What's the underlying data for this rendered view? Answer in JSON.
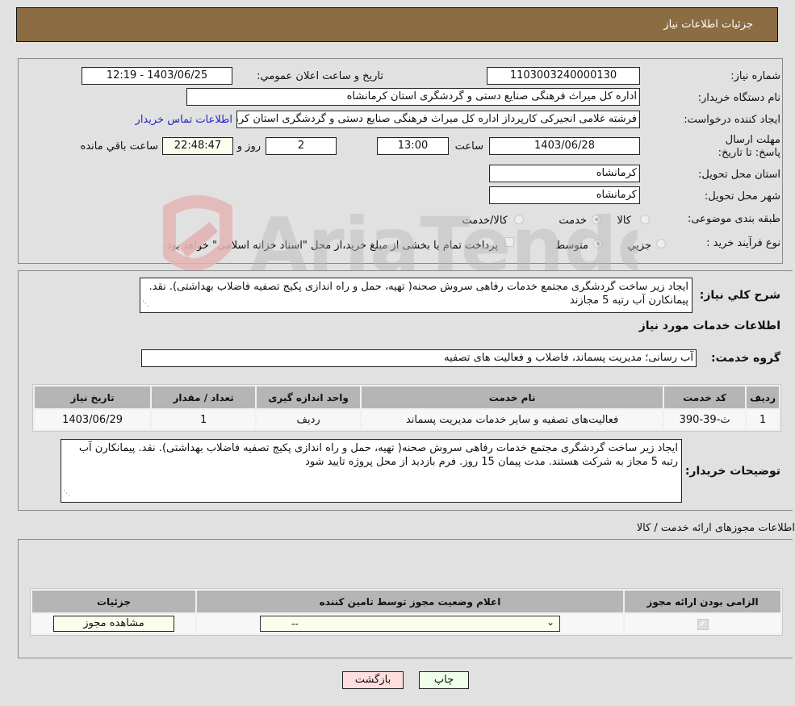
{
  "header": {
    "title": "جزئیات اطلاعات نیاز"
  },
  "details": {
    "need_number_label": "شماره نیاز:",
    "need_number": "1103003240000130",
    "announce_label": "تاریخ و ساعت اعلان عمومي:",
    "announce_value": "1403/06/25 - 12:19",
    "buyer_org_label": "نام دستگاه خریدار:",
    "buyer_org": "اداره کل میراث فرهنگی  صنایع دستی و گردشگری استان کرمانشاه",
    "creator_label": "ایجاد کننده درخواست:",
    "creator": "فرشته غلامی انجیرکی کارپرداز اداره کل میراث فرهنگی  صنایع دستی و گردشگری استان کرمانشاه",
    "buyer_contact_link": "اطلاعات تماس خریدار",
    "deadline_label": "مهلت ارسال پاسخ: تا تاریخ:",
    "deadline_date": "1403/06/28",
    "time_label": "ساعت",
    "deadline_time": "13:00",
    "days_value": "2",
    "days_label": "روز و",
    "remaining_time": "22:48:47",
    "remaining_label": "ساعت باقي مانده",
    "province_label": "استان محل تحویل:",
    "province": "کرمانشاه",
    "city_label": "شهر محل تحویل:",
    "city": "کرمانشاه",
    "category_label": "طبقه بندی موضوعی:",
    "category_options": [
      {
        "label": "کالا",
        "selected": false
      },
      {
        "label": "خدمت",
        "selected": true
      },
      {
        "label": "کالا/خدمت",
        "selected": false
      }
    ],
    "process_label": "نوع فرآیند خرید :",
    "process_options": [
      {
        "label": "جزيي",
        "selected": false
      },
      {
        "label": "متوسط",
        "selected": true
      }
    ],
    "treasury_checkbox_label": "پرداخت تمام یا بخشی از مبلغ خرید،از محل \"اسناد خزانه اسلامی\" خواهد بود."
  },
  "summary": {
    "label": "شرح کلي نیاز:",
    "text": "ایجاد زیر ساخت گردشگری مجتمع خدمات رفاهی سروش صحنه( تهیه، حمل و راه اندازی پکیج تصفیه فاضلاب بهداشتی). نقد. پیمانکارن آب رتبه 5 مجازند",
    "services_heading": "اطلاعات خدمات مورد نیاز",
    "service_group_label": "گروه خدمت:",
    "service_group": "آب رسانی؛ مدیریت پسماند، فاضلاب و فعالیت های تصفیه"
  },
  "services_table": {
    "headers": [
      "ردیف",
      "کد خدمت",
      "نام خدمت",
      "واحد اندازه گیری",
      "تعداد / مقدار",
      "تاریخ نیاز"
    ],
    "rows": [
      [
        "1",
        "ث-39-390",
        "فعالیت‌های تصفیه و سایر خدمات مدیریت پسماند",
        "ردیف",
        "1",
        "1403/06/29"
      ]
    ]
  },
  "buyer_notes": {
    "label": "توضیحات خریدار:",
    "text": "ایجاد زیر ساخت گردشگری مجتمع خدمات رفاهی سروش صحنه( تهیه، حمل و راه اندازی پکیج تصفیه فاضلاب بهداشتی). نقد. پیمانکارن آب رتبه 5 مجاز به شرکت هستند. مدت پیمان 15 روز. فرم بازدید از محل پروژه تایید شود"
  },
  "permits": {
    "heading": "اطلاعات مجوزهای ارائه خدمت / کالا",
    "headers": [
      "الزامی بودن ارائه مجوز",
      "اعلام وضعیت مجوز توسط تامین کننده",
      "جزئیات"
    ],
    "row": {
      "required_checked": true,
      "status_value": "--",
      "details_button": "مشاهده مجوز"
    }
  },
  "footer": {
    "print_button": "چاپ",
    "back_button": "بازگشت"
  },
  "colors": {
    "header_bg": "#8c6c42",
    "print_bg": "#eefee8",
    "back_bg": "#fedede",
    "link": "#2424c8"
  },
  "watermark": {
    "text": "AriaTender.neT"
  }
}
